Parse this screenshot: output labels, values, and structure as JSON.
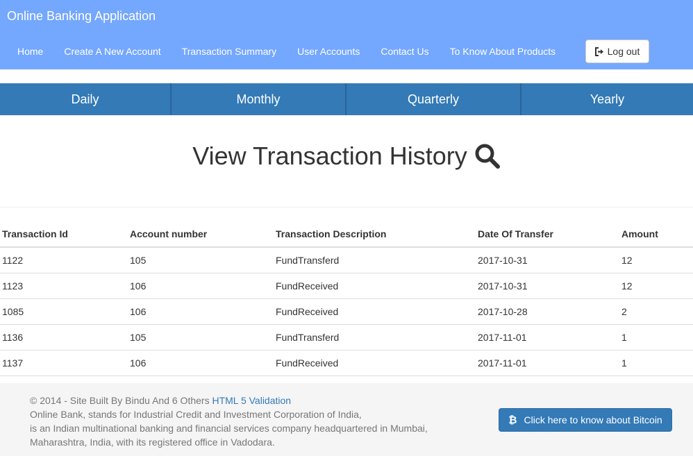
{
  "header": {
    "brand": "Online Banking Application",
    "nav": [
      "Home",
      "Create A New Account",
      "Transaction Summary",
      "User Accounts",
      "Contact Us",
      "To Know About Products"
    ],
    "logout_label": "Log out",
    "background_color": "#74a7fe"
  },
  "period_tabs": [
    "Daily",
    "Monthly",
    "Quarterly",
    "Yearly"
  ],
  "page_title": "View Transaction History",
  "table": {
    "columns": [
      "Transaction Id",
      "Account number",
      "Transaction Description",
      "Date Of Transfer",
      "Amount"
    ],
    "rows": [
      [
        "1122",
        "105",
        "FundTransferd",
        "2017-10-31",
        "12"
      ],
      [
        "1123",
        "106",
        "FundReceived",
        "2017-10-31",
        "12"
      ],
      [
        "1085",
        "106",
        "FundReceived",
        "2017-10-28",
        "2"
      ],
      [
        "1136",
        "105",
        "FundTransferd",
        "2017-11-01",
        "1"
      ],
      [
        "1137",
        "106",
        "FundReceived",
        "2017-11-01",
        "1"
      ]
    ]
  },
  "footer": {
    "copyright": "© 2014 - Site Built By Bindu And 6 Others",
    "validation_link": "HTML 5 Validation",
    "line1": "Online Bank, stands for Industrial Credit and Investment Corporation of India,",
    "line2": "is an Indian multinational banking and financial services company headquartered in Mumbai,",
    "line3": "Maharashtra, India, with its registered office in Vadodara.",
    "bitcoin_button": "Click here to know about Bitcoin",
    "accent_color": "#337ab7"
  }
}
